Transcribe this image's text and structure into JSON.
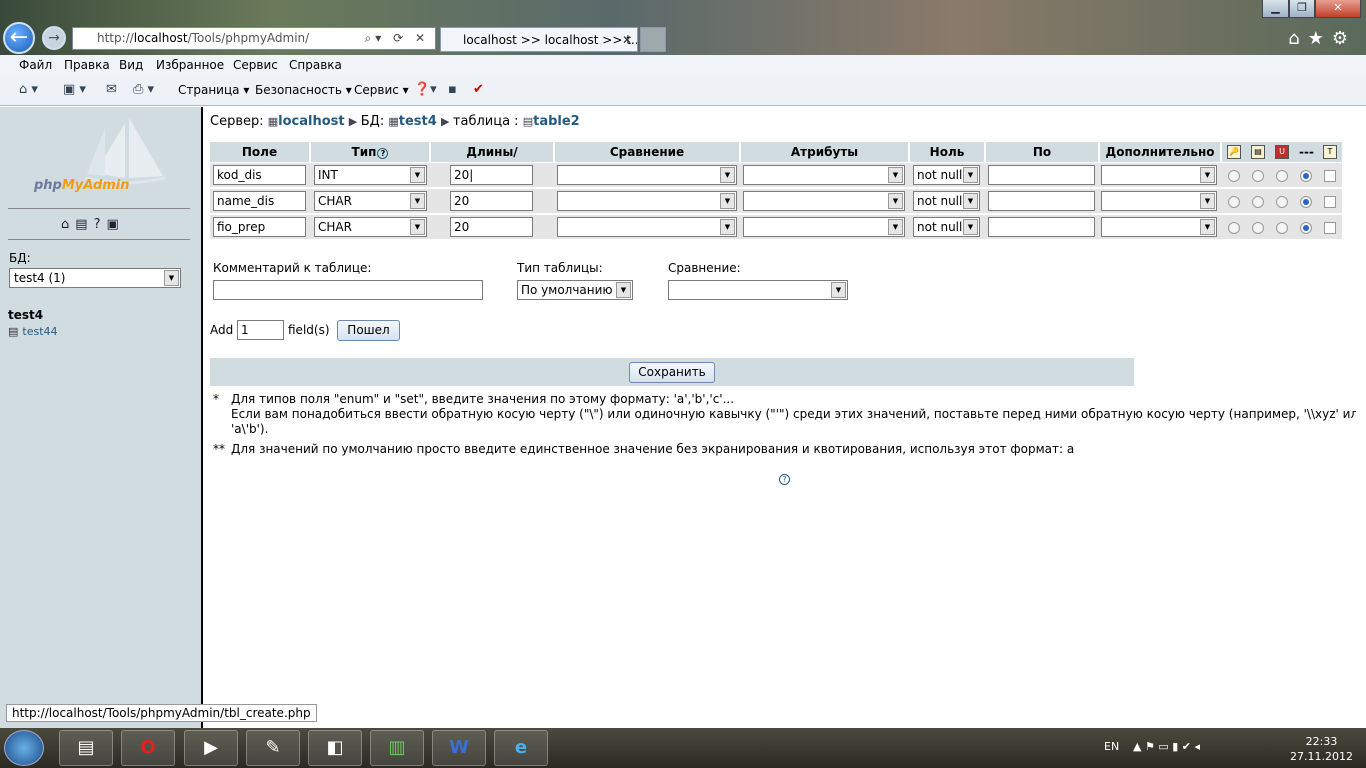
{
  "browser": {
    "address_scheme": "http://",
    "address_host": "localhost",
    "address_path": "/Tools/phpmyAdmin/",
    "tab_title": "localhost >> localhost >> t...",
    "menu": [
      "Файл",
      "Правка",
      "Вид",
      "Избранное",
      "Сервис",
      "Справка"
    ],
    "cmd_page": "Страница",
    "cmd_security": "Безопасность",
    "cmd_service": "Сервис",
    "status_url": "http://localhost/Tools/phpmyAdmin/tbl_create.php"
  },
  "sidebar": {
    "logo_php": "php",
    "logo_myadmin": "MyAdmin",
    "db_label": "БД:",
    "db_selected": "test4 (1)",
    "db_name": "test4",
    "tables": [
      "test44"
    ]
  },
  "breadcrumb": {
    "server_label": "Сервер:",
    "server": "localhost",
    "db_label": "БД:",
    "db": "test4",
    "table_label": "таблица :",
    "table": "table2"
  },
  "columns": {
    "field": "Поле",
    "type": "Тип",
    "length": "Длины/Значения*",
    "collation": "Сравнение",
    "attributes": "Атрибуты",
    "null": "Ноль",
    "default": "По умолчанию**",
    "extra": "Дополнительно",
    "none": "---"
  },
  "rows": [
    {
      "field": "kod_dis",
      "type": "INT",
      "length": "20",
      "null": "not null"
    },
    {
      "field": "name_dis",
      "type": "CHAR",
      "length": "20",
      "null": "not null"
    },
    {
      "field": "fio_prep",
      "type": "CHAR",
      "length": "20",
      "null": "not null"
    }
  ],
  "table_options": {
    "comment_label": "Комментарий к таблице:",
    "comment_value": "",
    "engine_label": "Тип таблицы:",
    "engine_value": "По умолчанию",
    "collation_label": "Сравнение:",
    "collation_value": ""
  },
  "add_fields": {
    "prefix": "Add",
    "count": "1",
    "suffix": "field(s)",
    "go_label": "Пошел"
  },
  "save_label": "Сохранить",
  "notes": {
    "star1": "*",
    "note1_line1": "Для типов поля \"enum\" и \"set\", введите значения по этому формату: 'a','b','c'...",
    "note1_line2": "Если вам понадобиться ввести обратную косую черту (\"\\\") или одиночную кавычку (\"'\") среди этих значений, поставьте перед ними обратную косую черту (например, '\\\\xyz' или",
    "note1_line3": "'a\\'b').",
    "star2": "**",
    "note2": "Для значений по умолчанию просто введите единственное значение без экранирования и квотирования, используя этот формат: a"
  },
  "taskbar": {
    "lang": "EN",
    "time": "22:33",
    "date": "27.11.2012"
  }
}
